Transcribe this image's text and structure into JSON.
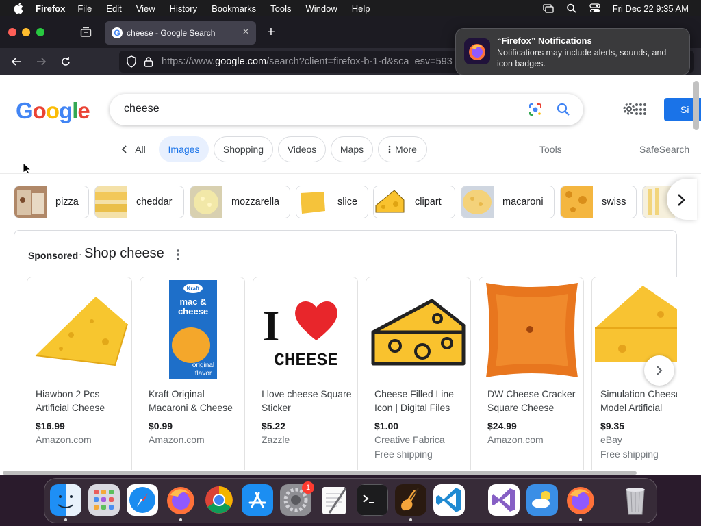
{
  "menubar": {
    "app_name": "Firefox",
    "items": [
      "File",
      "Edit",
      "View",
      "History",
      "Bookmarks",
      "Tools",
      "Window",
      "Help"
    ],
    "datetime": "Fri Dec 22  9:35 AM"
  },
  "browser": {
    "tab_title": "cheese - Google Search",
    "tab_close": "×",
    "new_tab": "+",
    "url_prefix": "https://www.",
    "url_domain": "google.com",
    "url_rest": "/search?client=firefox-b-1-d&sca_esv=593"
  },
  "notification": {
    "title": "“Firefox” Notifications",
    "body": "Notifications may include alerts, sounds, and icon badges."
  },
  "google": {
    "logo": [
      "G",
      "o",
      "o",
      "g",
      "l",
      "e"
    ],
    "query": "cheese",
    "signin_label": "Si"
  },
  "filters": {
    "all": "All",
    "images": "Images",
    "shopping": "Shopping",
    "videos": "Videos",
    "maps": "Maps",
    "more": "More",
    "tools": "Tools",
    "safesearch": "SafeSearch"
  },
  "refinements": [
    "pizza",
    "cheddar",
    "mozzarella",
    "slice",
    "clipart",
    "macaroni",
    "swiss"
  ],
  "shop": {
    "sponsored": "Sponsored",
    "separator": "·",
    "title": "Shop cheese",
    "products": [
      {
        "name": "Hiawbon 2 Pcs Artificial Cheese",
        "price": "$16.99",
        "store": "Amazon.com",
        "shipping": ""
      },
      {
        "name": "Kraft Original Macaroni & Cheese",
        "price": "$0.99",
        "store": "Amazon.com",
        "shipping": ""
      },
      {
        "name": "I love cheese Square Sticker",
        "price": "$5.22",
        "store": "Zazzle",
        "shipping": ""
      },
      {
        "name": "Cheese Filled Line Icon | Digital Files",
        "price": "$1.00",
        "store": "Creative Fabrica",
        "shipping": "Free shipping"
      },
      {
        "name": "DW Cheese Cracker Square Cheese",
        "price": "$24.99",
        "store": "Amazon.com",
        "shipping": ""
      },
      {
        "name": "Simulation Cheese Model Artificial",
        "price": "$9.35",
        "store": "eBay",
        "shipping": "Free shipping"
      }
    ]
  },
  "product_images": {
    "kraft_brand": "Kraft",
    "kraft_line1": "mac &",
    "kraft_line2": "cheese",
    "kraft_sub1": "original",
    "kraft_sub2": "flavor",
    "sticker_i": "I",
    "sticker_word": "CHEESE"
  },
  "dock": {
    "badge_count": "1",
    "icons": [
      "finder-icon",
      "launchpad-icon",
      "safari-icon",
      "firefox-icon",
      "chrome-icon",
      "app-store-icon",
      "system-settings-icon",
      "textedit-icon",
      "terminal-icon",
      "garageband-icon",
      "vscode-icon",
      "visual-studio-icon",
      "weather-icon",
      "firefox-dev-icon",
      "trash-icon"
    ]
  },
  "colors": {
    "google_blue": "#1a73e8",
    "chip_active_bg": "#e8f0fe",
    "cheese_yellow": "#f9c22e"
  }
}
